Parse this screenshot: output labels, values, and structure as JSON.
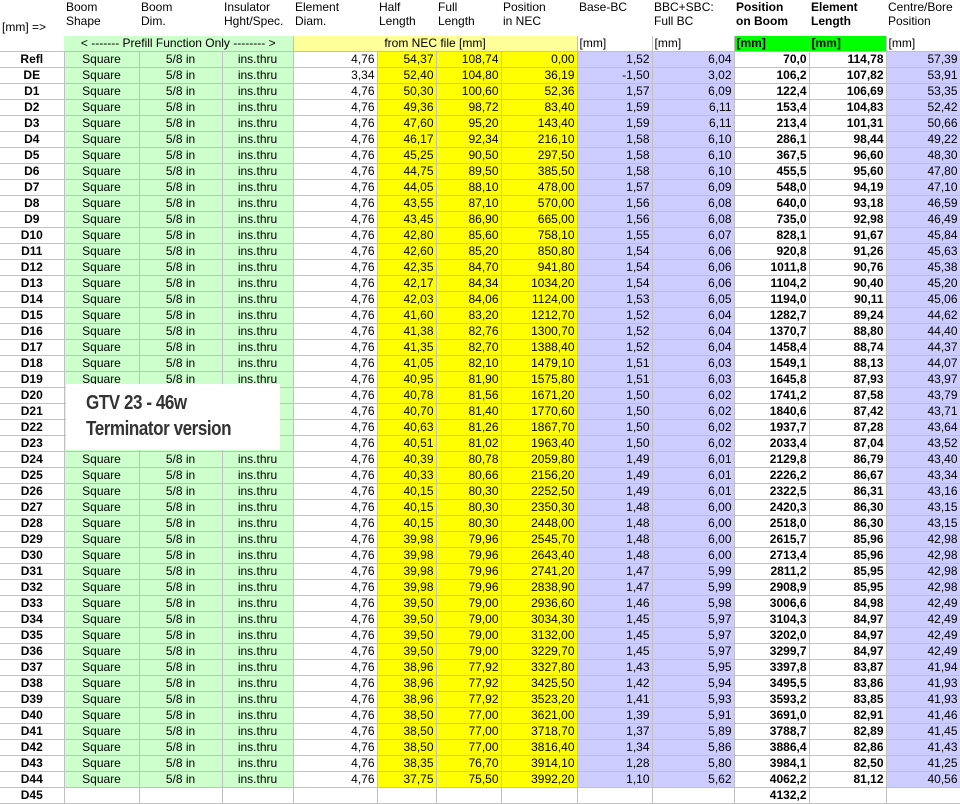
{
  "header": {
    "row_label": "[mm] =>",
    "boom_shape": [
      "Boom",
      "Shape"
    ],
    "boom_dim": [
      "Boom",
      "Dim."
    ],
    "insulator": [
      "Insulator",
      "Hght/Spec."
    ],
    "element_diam": [
      "Element",
      "Diam."
    ],
    "half_length": [
      "Half",
      "Length"
    ],
    "full_length": [
      "Full",
      "Length"
    ],
    "position_nec": [
      "Position",
      "in NEC"
    ],
    "base_bc": [
      "",
      "Base-BC"
    ],
    "bbc_sbc": [
      "BBC+SBC:",
      "Full BC"
    ],
    "position_boom": [
      "Position",
      "on Boom"
    ],
    "element_length": [
      "Element",
      "Length"
    ],
    "centre_bore": [
      "Centre/Bore",
      "Position"
    ]
  },
  "band": {
    "prefill": "< ------- Prefill Function Only -------- >",
    "nec": "from NEC file [mm]",
    "base_unit": "[mm]",
    "bbc_unit": "[mm]",
    "pos_unit": "[mm]",
    "len_unit": "[mm]",
    "centre_unit": "[mm]"
  },
  "overlay": {
    "line1": "GTV 23 - 46w",
    "line2": "Terminator version"
  },
  "rows": [
    [
      "Refl",
      "Square",
      "5/8 in",
      "ins.thru",
      "4,76",
      "54,37",
      "108,74",
      "0,00",
      "1,52",
      "6,04",
      "70,0",
      "114,78",
      "57,39"
    ],
    [
      "DE",
      "Square",
      "5/8 in",
      "ins.thru",
      "3,34",
      "52,40",
      "104,80",
      "36,19",
      "-1,50",
      "3,02",
      "106,2",
      "107,82",
      "53,91"
    ],
    [
      "D1",
      "Square",
      "5/8 in",
      "ins.thru",
      "4,76",
      "50,30",
      "100,60",
      "52,36",
      "1,57",
      "6,09",
      "122,4",
      "106,69",
      "53,35"
    ],
    [
      "D2",
      "Square",
      "5/8 in",
      "ins.thru",
      "4,76",
      "49,36",
      "98,72",
      "83,40",
      "1,59",
      "6,11",
      "153,4",
      "104,83",
      "52,42"
    ],
    [
      "D3",
      "Square",
      "5/8 in",
      "ins.thru",
      "4,76",
      "47,60",
      "95,20",
      "143,40",
      "1,59",
      "6,11",
      "213,4",
      "101,31",
      "50,66"
    ],
    [
      "D4",
      "Square",
      "5/8 in",
      "ins.thru",
      "4,76",
      "46,17",
      "92,34",
      "216,10",
      "1,58",
      "6,10",
      "286,1",
      "98,44",
      "49,22"
    ],
    [
      "D5",
      "Square",
      "5/8 in",
      "ins.thru",
      "4,76",
      "45,25",
      "90,50",
      "297,50",
      "1,58",
      "6,10",
      "367,5",
      "96,60",
      "48,30"
    ],
    [
      "D6",
      "Square",
      "5/8 in",
      "ins.thru",
      "4,76",
      "44,75",
      "89,50",
      "385,50",
      "1,58",
      "6,10",
      "455,5",
      "95,60",
      "47,80"
    ],
    [
      "D7",
      "Square",
      "5/8 in",
      "ins.thru",
      "4,76",
      "44,05",
      "88,10",
      "478,00",
      "1,57",
      "6,09",
      "548,0",
      "94,19",
      "47,10"
    ],
    [
      "D8",
      "Square",
      "5/8 in",
      "ins.thru",
      "4,76",
      "43,55",
      "87,10",
      "570,00",
      "1,56",
      "6,08",
      "640,0",
      "93,18",
      "46,59"
    ],
    [
      "D9",
      "Square",
      "5/8 in",
      "ins.thru",
      "4,76",
      "43,45",
      "86,90",
      "665,00",
      "1,56",
      "6,08",
      "735,0",
      "92,98",
      "46,49"
    ],
    [
      "D10",
      "Square",
      "5/8 in",
      "ins.thru",
      "4,76",
      "42,80",
      "85,60",
      "758,10",
      "1,55",
      "6,07",
      "828,1",
      "91,67",
      "45,84"
    ],
    [
      "D11",
      "Square",
      "5/8 in",
      "ins.thru",
      "4,76",
      "42,60",
      "85,20",
      "850,80",
      "1,54",
      "6,06",
      "920,8",
      "91,26",
      "45,63"
    ],
    [
      "D12",
      "Square",
      "5/8 in",
      "ins.thru",
      "4,76",
      "42,35",
      "84,70",
      "941,80",
      "1,54",
      "6,06",
      "1011,8",
      "90,76",
      "45,38"
    ],
    [
      "D13",
      "Square",
      "5/8 in",
      "ins.thru",
      "4,76",
      "42,17",
      "84,34",
      "1034,20",
      "1,54",
      "6,06",
      "1104,2",
      "90,40",
      "45,20"
    ],
    [
      "D14",
      "Square",
      "5/8 in",
      "ins.thru",
      "4,76",
      "42,03",
      "84,06",
      "1124,00",
      "1,53",
      "6,05",
      "1194,0",
      "90,11",
      "45,06"
    ],
    [
      "D15",
      "Square",
      "5/8 in",
      "ins.thru",
      "4,76",
      "41,60",
      "83,20",
      "1212,70",
      "1,52",
      "6,04",
      "1282,7",
      "89,24",
      "44,62"
    ],
    [
      "D16",
      "Square",
      "5/8 in",
      "ins.thru",
      "4,76",
      "41,38",
      "82,76",
      "1300,70",
      "1,52",
      "6,04",
      "1370,7",
      "88,80",
      "44,40"
    ],
    [
      "D17",
      "Square",
      "5/8 in",
      "ins.thru",
      "4,76",
      "41,35",
      "82,70",
      "1388,40",
      "1,52",
      "6,04",
      "1458,4",
      "88,74",
      "44,37"
    ],
    [
      "D18",
      "Square",
      "5/8 in",
      "ins.thru",
      "4,76",
      "41,05",
      "82,10",
      "1479,10",
      "1,51",
      "6,03",
      "1549,1",
      "88,13",
      "44,07"
    ],
    [
      "D19",
      "Square",
      "5/8 in",
      "ins.thru",
      "4,76",
      "40,95",
      "81,90",
      "1575,80",
      "1,51",
      "6,03",
      "1645,8",
      "87,93",
      "43,97"
    ],
    [
      "D20",
      "",
      "",
      "",
      "4,76",
      "40,78",
      "81,56",
      "1671,20",
      "1,50",
      "6,02",
      "1741,2",
      "87,58",
      "43,79"
    ],
    [
      "D21",
      "",
      "",
      "",
      "4,76",
      "40,70",
      "81,40",
      "1770,60",
      "1,50",
      "6,02",
      "1840,6",
      "87,42",
      "43,71"
    ],
    [
      "D22",
      "",
      "",
      "",
      "4,76",
      "40,63",
      "81,26",
      "1867,70",
      "1,50",
      "6,02",
      "1937,7",
      "87,28",
      "43,64"
    ],
    [
      "D23",
      "",
      "",
      "",
      "4,76",
      "40,51",
      "81,02",
      "1963,40",
      "1,50",
      "6,02",
      "2033,4",
      "87,04",
      "43,52"
    ],
    [
      "D24",
      "Square",
      "5/8 in",
      "ins.thru",
      "4,76",
      "40,39",
      "80,78",
      "2059,80",
      "1,49",
      "6,01",
      "2129,8",
      "86,79",
      "43,40"
    ],
    [
      "D25",
      "Square",
      "5/8 in",
      "ins.thru",
      "4,76",
      "40,33",
      "80,66",
      "2156,20",
      "1,49",
      "6,01",
      "2226,2",
      "86,67",
      "43,34"
    ],
    [
      "D26",
      "Square",
      "5/8 in",
      "ins.thru",
      "4,76",
      "40,15",
      "80,30",
      "2252,50",
      "1,49",
      "6,01",
      "2322,5",
      "86,31",
      "43,16"
    ],
    [
      "D27",
      "Square",
      "5/8 in",
      "ins.thru",
      "4,76",
      "40,15",
      "80,30",
      "2350,30",
      "1,48",
      "6,00",
      "2420,3",
      "86,30",
      "43,15"
    ],
    [
      "D28",
      "Square",
      "5/8 in",
      "ins.thru",
      "4,76",
      "40,15",
      "80,30",
      "2448,00",
      "1,48",
      "6,00",
      "2518,0",
      "86,30",
      "43,15"
    ],
    [
      "D29",
      "Square",
      "5/8 in",
      "ins.thru",
      "4,76",
      "39,98",
      "79,96",
      "2545,70",
      "1,48",
      "6,00",
      "2615,7",
      "85,96",
      "42,98"
    ],
    [
      "D30",
      "Square",
      "5/8 in",
      "ins.thru",
      "4,76",
      "39,98",
      "79,96",
      "2643,40",
      "1,48",
      "6,00",
      "2713,4",
      "85,96",
      "42,98"
    ],
    [
      "D31",
      "Square",
      "5/8 in",
      "ins.thru",
      "4,76",
      "39,98",
      "79,96",
      "2741,20",
      "1,47",
      "5,99",
      "2811,2",
      "85,95",
      "42,98"
    ],
    [
      "D32",
      "Square",
      "5/8 in",
      "ins.thru",
      "4,76",
      "39,98",
      "79,96",
      "2838,90",
      "1,47",
      "5,99",
      "2908,9",
      "85,95",
      "42,98"
    ],
    [
      "D33",
      "Square",
      "5/8 in",
      "ins.thru",
      "4,76",
      "39,50",
      "79,00",
      "2936,60",
      "1,46",
      "5,98",
      "3006,6",
      "84,98",
      "42,49"
    ],
    [
      "D34",
      "Square",
      "5/8 in",
      "ins.thru",
      "4,76",
      "39,50",
      "79,00",
      "3034,30",
      "1,45",
      "5,97",
      "3104,3",
      "84,97",
      "42,49"
    ],
    [
      "D35",
      "Square",
      "5/8 in",
      "ins.thru",
      "4,76",
      "39,50",
      "79,00",
      "3132,00",
      "1,45",
      "5,97",
      "3202,0",
      "84,97",
      "42,49"
    ],
    [
      "D36",
      "Square",
      "5/8 in",
      "ins.thru",
      "4,76",
      "39,50",
      "79,00",
      "3229,70",
      "1,45",
      "5,97",
      "3299,7",
      "84,97",
      "42,49"
    ],
    [
      "D37",
      "Square",
      "5/8 in",
      "ins.thru",
      "4,76",
      "38,96",
      "77,92",
      "3327,80",
      "1,43",
      "5,95",
      "3397,8",
      "83,87",
      "41,94"
    ],
    [
      "D38",
      "Square",
      "5/8 in",
      "ins.thru",
      "4,76",
      "38,96",
      "77,92",
      "3425,50",
      "1,42",
      "5,94",
      "3495,5",
      "83,86",
      "41,93"
    ],
    [
      "D39",
      "Square",
      "5/8 in",
      "ins.thru",
      "4,76",
      "38,96",
      "77,92",
      "3523,20",
      "1,41",
      "5,93",
      "3593,2",
      "83,85",
      "41,93"
    ],
    [
      "D40",
      "Square",
      "5/8 in",
      "ins.thru",
      "4,76",
      "38,50",
      "77,00",
      "3621,00",
      "1,39",
      "5,91",
      "3691,0",
      "82,91",
      "41,46"
    ],
    [
      "D41",
      "Square",
      "5/8 in",
      "ins.thru",
      "4,76",
      "38,50",
      "77,00",
      "3718,70",
      "1,37",
      "5,89",
      "3788,7",
      "82,89",
      "41,45"
    ],
    [
      "D42",
      "Square",
      "5/8 in",
      "ins.thru",
      "4,76",
      "38,50",
      "77,00",
      "3816,40",
      "1,34",
      "5,86",
      "3886,4",
      "82,86",
      "41,43"
    ],
    [
      "D43",
      "Square",
      "5/8 in",
      "ins.thru",
      "4,76",
      "38,35",
      "76,70",
      "3914,10",
      "1,28",
      "5,80",
      "3984,1",
      "82,50",
      "41,25"
    ],
    [
      "D44",
      "Square",
      "5/8 in",
      "ins.thru",
      "4,76",
      "37,75",
      "75,50",
      "3992,20",
      "1,10",
      "5,62",
      "4062,2",
      "81,12",
      "40,56"
    ],
    [
      "D45",
      "",
      "",
      "",
      "",
      "",
      "",
      "",
      "",
      "",
      "4132,2",
      "",
      ""
    ]
  ]
}
